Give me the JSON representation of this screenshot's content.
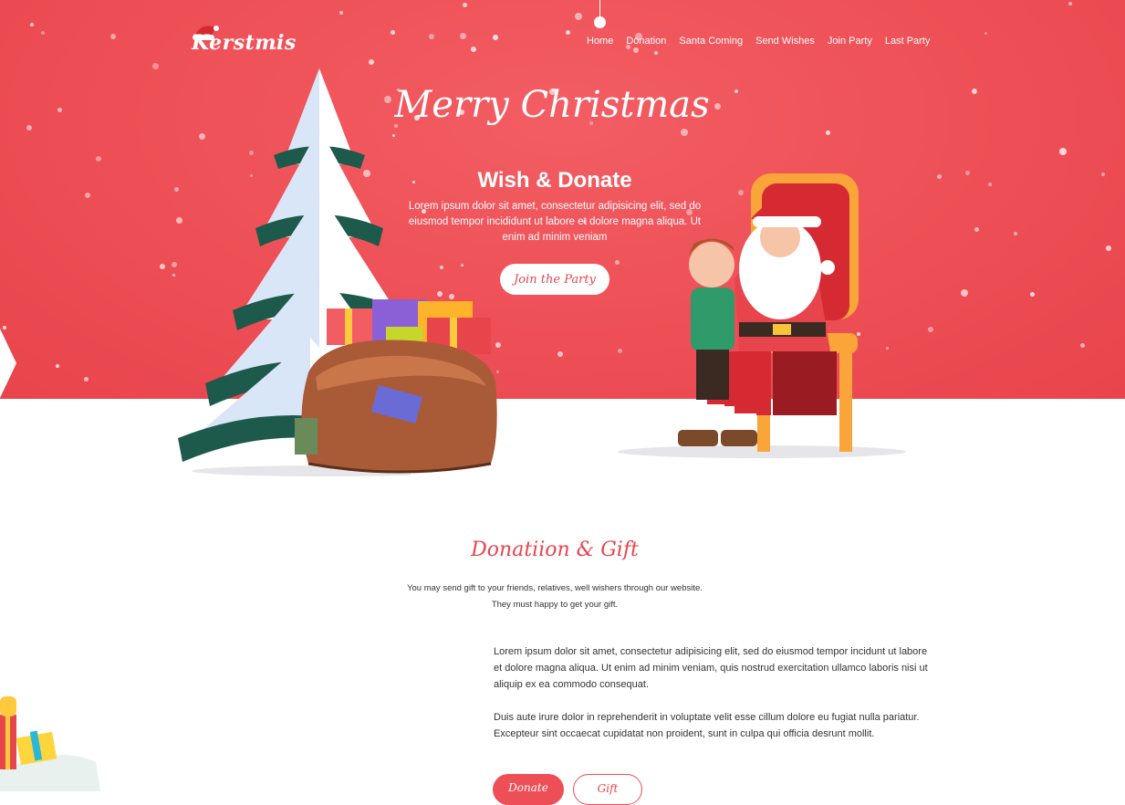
{
  "brand": {
    "name": "Kerstmis"
  },
  "nav": {
    "items": [
      {
        "label": "Home"
      },
      {
        "label": "Donation"
      },
      {
        "label": "Santa Coming"
      },
      {
        "label": "Send Wishes"
      },
      {
        "label": "Join Party"
      },
      {
        "label": "Last Party"
      }
    ]
  },
  "hero": {
    "script_title": "Merry Christmas",
    "title": "Wish & Donate",
    "description": "Lorem ipsum dolor sit amet, consectetur adipisicing elit, sed do eiusmod tempor incididunt ut labore et dolore magna aliqua. Ut enim ad minim veniam",
    "cta_label": "Join the Party"
  },
  "donation": {
    "title": "Donatiion & Gift",
    "subtitle_line1": "You may send gift to your friends, relatives, well wishers through our website.",
    "subtitle_line2": "They must happy to get your gift.",
    "paragraph1": "Lorem ipsum dolor sit amet, consectetur adipisicing elit, sed do eiusmod tempor incidunt ut labore et dolore magna aliqua. Ut enim ad minim veniam, quis nostrud exercitation ullamco laboris nisi ut aliquip ex ea commodo consequat.",
    "paragraph2": "Duis aute irure dolor in reprehenderit in voluptate velit esse cillum dolore eu fugiat nulla pariatur. Excepteur sint occaecat cupidatat non proident, sunt in culpa qui officia desrunt mollit.",
    "donate_label": "Donate",
    "gift_label": "Gift"
  },
  "colors": {
    "primary": "#ee4f56",
    "hero_bg": "#e8444c",
    "tree_green": "#1d5a4c",
    "snow": "#ffffff"
  },
  "icons": {
    "logo_hat": "santa-hat-icon",
    "ornament": "ornament-icon"
  }
}
